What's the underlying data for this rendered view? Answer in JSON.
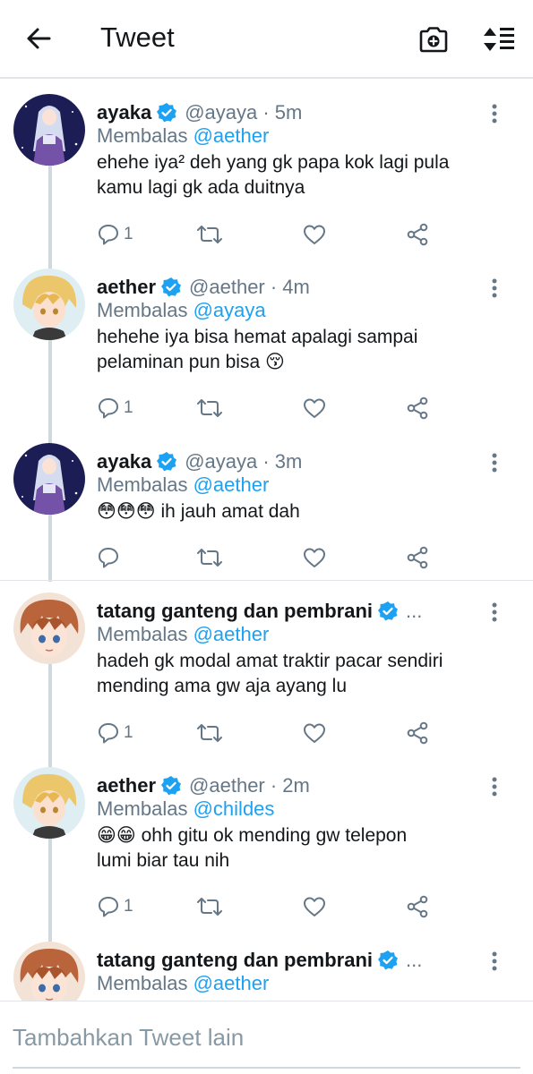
{
  "header": {
    "title": "Tweet",
    "icons": {
      "back": "arrow-left-icon",
      "camera": "camera-plus-icon",
      "sort": "sort-icon"
    }
  },
  "colors": {
    "accent": "#1da1f2",
    "secondary_text": "#657786",
    "text": "#14171a",
    "divider": "#e1e4e8"
  },
  "tweets": [
    {
      "avatar": "ayaka-avatar",
      "name": "ayaka",
      "handle": "@ayaya · 5m",
      "reply_prefix": "Membalas ",
      "reply_mention": "@aether",
      "text_lines": [
        "ehehe iya² deh yang gk papa kok lagi pula",
        "kamu lagi gk ada duitnya"
      ],
      "reply_count": "1"
    },
    {
      "avatar": "aether-avatar",
      "name": "aether",
      "handle": "@aether · 4m",
      "reply_prefix": "Membalas ",
      "reply_mention": "@ayaya",
      "text_lines": [
        "hehehe iya bisa hemat apalagi sampai",
        "pelaminan pun bisa 😚"
      ],
      "reply_count": "1"
    },
    {
      "avatar": "ayaka-avatar",
      "name": "ayaka",
      "handle": "@ayaya · 3m",
      "reply_prefix": "Membalas ",
      "reply_mention": "@aether",
      "text_lines": [
        "😳😳😳 ih jauh amat dah"
      ],
      "reply_count": ""
    },
    {
      "avatar": "childe-avatar",
      "name": "tatang ganteng dan pembrani",
      "handle": "...",
      "reply_prefix": "Membalas ",
      "reply_mention": "@aether",
      "text_lines": [
        "hadeh gk modal amat traktir pacar sendiri",
        "mending ama gw aja ayang lu"
      ],
      "reply_count": "1"
    },
    {
      "avatar": "aether-avatar",
      "name": "aether",
      "handle": "@aether · 2m",
      "reply_prefix": "Membalas ",
      "reply_mention": "@childes",
      "text_lines": [
        "😁😁 ohh gitu ok mending gw telepon",
        "lumi biar tau nih"
      ],
      "reply_count": "1"
    },
    {
      "avatar": "childe-avatar",
      "name": "tatang ganteng dan pembrani",
      "handle": "...",
      "reply_prefix": "Membalas ",
      "reply_mention": "@aether",
      "text_lines": [],
      "reply_count": ""
    }
  ],
  "compose": {
    "placeholder": "Tambahkan Tweet lain"
  }
}
